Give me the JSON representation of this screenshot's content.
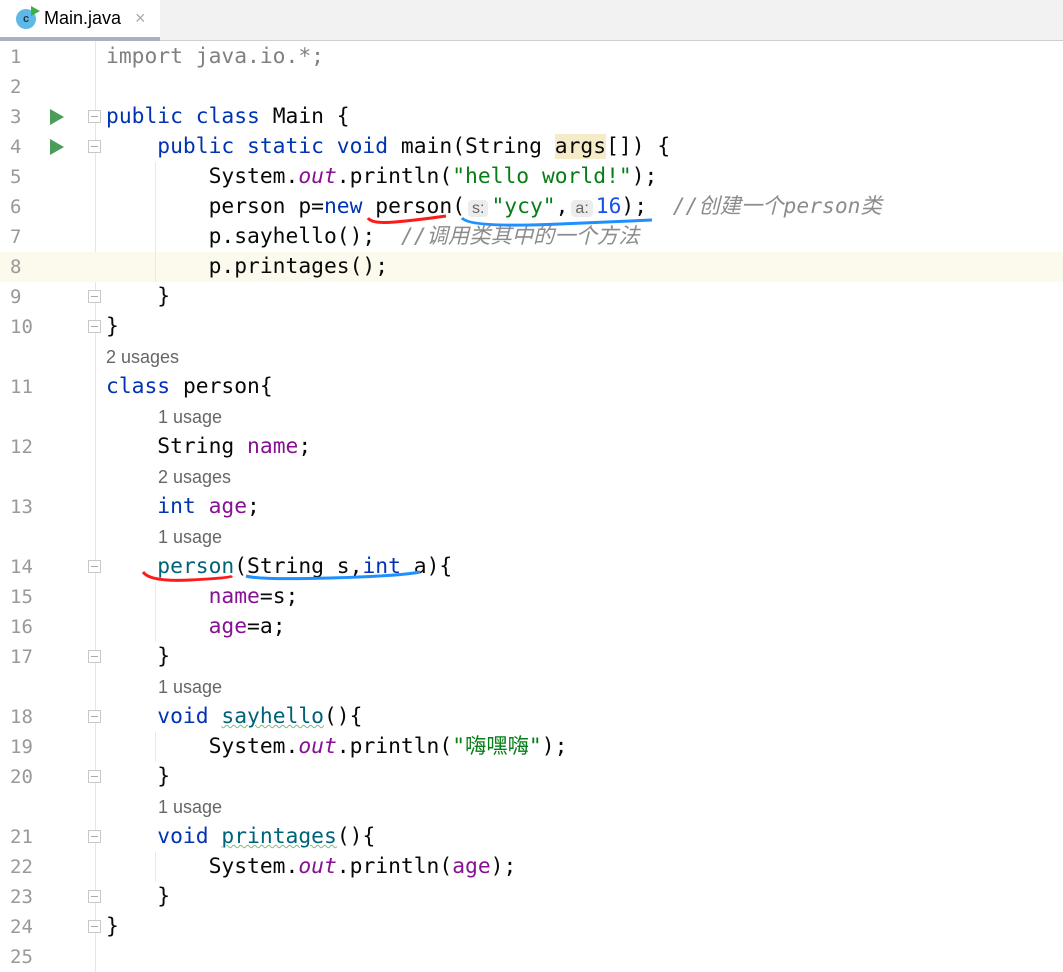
{
  "tab": {
    "label": "Main.java",
    "icon": "java-class-icon",
    "close": "×"
  },
  "rows": [
    {
      "n": "1",
      "t": [
        [
          "import java.io.*;",
          "imp"
        ]
      ]
    },
    {
      "n": "2",
      "t": []
    },
    {
      "n": "3",
      "run": true,
      "fold": true,
      "t": [
        [
          "public class ",
          "kw"
        ],
        [
          "Main {",
          ""
        ]
      ]
    },
    {
      "n": "4",
      "run": true,
      "fold": true,
      "t": [
        [
          "    public static void ",
          "kw"
        ],
        [
          "main(String ",
          ""
        ],
        [
          "args",
          "ar"
        ],
        [
          "[]) {",
          ""
        ]
      ]
    },
    {
      "n": "5",
      "t": [
        [
          "        System.",
          ""
        ],
        [
          "out",
          "it"
        ],
        [
          ".println(",
          ""
        ],
        [
          "\"hello world!\"",
          "str"
        ],
        [
          ");",
          ""
        ]
      ]
    },
    {
      "n": "6",
      "t": [
        [
          "        person p=",
          ""
        ],
        [
          "new",
          "kw"
        ],
        [
          " person(",
          ""
        ],
        [
          "s:",
          "hint"
        ],
        [
          "\"ycy\"",
          "str"
        ],
        [
          ",",
          ""
        ],
        [
          "a:",
          "hint"
        ],
        [
          "16",
          "num"
        ],
        [
          ");  ",
          ""
        ],
        [
          "//创建一个person类",
          "cm"
        ]
      ]
    },
    {
      "n": "7",
      "t": [
        [
          "        p.sayhello();  ",
          ""
        ],
        [
          "//调用类其中的一个方法",
          "cm"
        ]
      ]
    },
    {
      "n": "8",
      "hl": true,
      "t": [
        [
          "        p.printages();",
          ""
        ]
      ]
    },
    {
      "n": "9",
      "fold": true,
      "t": [
        [
          "    }",
          ""
        ]
      ]
    },
    {
      "n": "10",
      "fold": true,
      "t": [
        [
          "}",
          ""
        ]
      ]
    },
    {
      "usage": "2 usages",
      "indent": 0
    },
    {
      "n": "11",
      "t": [
        [
          "class ",
          "kw"
        ],
        [
          "person{",
          ""
        ]
      ]
    },
    {
      "usage": "1 usage",
      "indent": 1
    },
    {
      "n": "12",
      "t": [
        [
          "    String ",
          ""
        ],
        [
          "name",
          "fld"
        ],
        [
          ";",
          ""
        ]
      ]
    },
    {
      "usage": "2 usages",
      "indent": 1
    },
    {
      "n": "13",
      "t": [
        [
          "    int ",
          "kw"
        ],
        [
          "age",
          "fld"
        ],
        [
          ";",
          ""
        ]
      ]
    },
    {
      "usage": "1 usage",
      "indent": 1
    },
    {
      "n": "14",
      "fold": true,
      "t": [
        [
          "    ",
          ""
        ],
        [
          "person",
          "mth"
        ],
        [
          "(String s,",
          ""
        ],
        [
          "int",
          "kw"
        ],
        [
          " a){",
          ""
        ]
      ]
    },
    {
      "n": "15",
      "t": [
        [
          "        ",
          ""
        ],
        [
          "name",
          "fld"
        ],
        [
          "=s;",
          ""
        ]
      ]
    },
    {
      "n": "16",
      "t": [
        [
          "        ",
          ""
        ],
        [
          "age",
          "fld"
        ],
        [
          "=a;",
          ""
        ]
      ]
    },
    {
      "n": "17",
      "fold": true,
      "t": [
        [
          "    }",
          ""
        ]
      ]
    },
    {
      "usage": "1 usage",
      "indent": 1
    },
    {
      "n": "18",
      "fold": true,
      "t": [
        [
          "    void ",
          "kw"
        ],
        [
          "sayhello",
          "mth sq"
        ],
        [
          "(){",
          ""
        ]
      ]
    },
    {
      "n": "19",
      "t": [
        [
          "        System.",
          ""
        ],
        [
          "out",
          "it"
        ],
        [
          ".println(",
          ""
        ],
        [
          "\"嗨嘿嗨\"",
          "str"
        ],
        [
          ");",
          ""
        ]
      ]
    },
    {
      "n": "20",
      "fold": true,
      "t": [
        [
          "    }",
          ""
        ]
      ]
    },
    {
      "usage": "1 usage",
      "indent": 1
    },
    {
      "n": "21",
      "fold": true,
      "t": [
        [
          "    void ",
          "kw"
        ],
        [
          "printages",
          "mth sq"
        ],
        [
          "(){",
          ""
        ]
      ]
    },
    {
      "n": "22",
      "t": [
        [
          "        System.",
          ""
        ],
        [
          "out",
          "it"
        ],
        [
          ".println(",
          ""
        ],
        [
          "age",
          "fld"
        ],
        [
          ");",
          ""
        ]
      ]
    },
    {
      "n": "23",
      "fold": true,
      "t": [
        [
          "    }",
          ""
        ]
      ]
    },
    {
      "n": "24",
      "fold": true,
      "t": [
        [
          "}",
          ""
        ]
      ]
    },
    {
      "n": "25",
      "t": []
    }
  ],
  "annotations": {
    "red": "#ff1a1a",
    "blue": "#1e90ff"
  }
}
